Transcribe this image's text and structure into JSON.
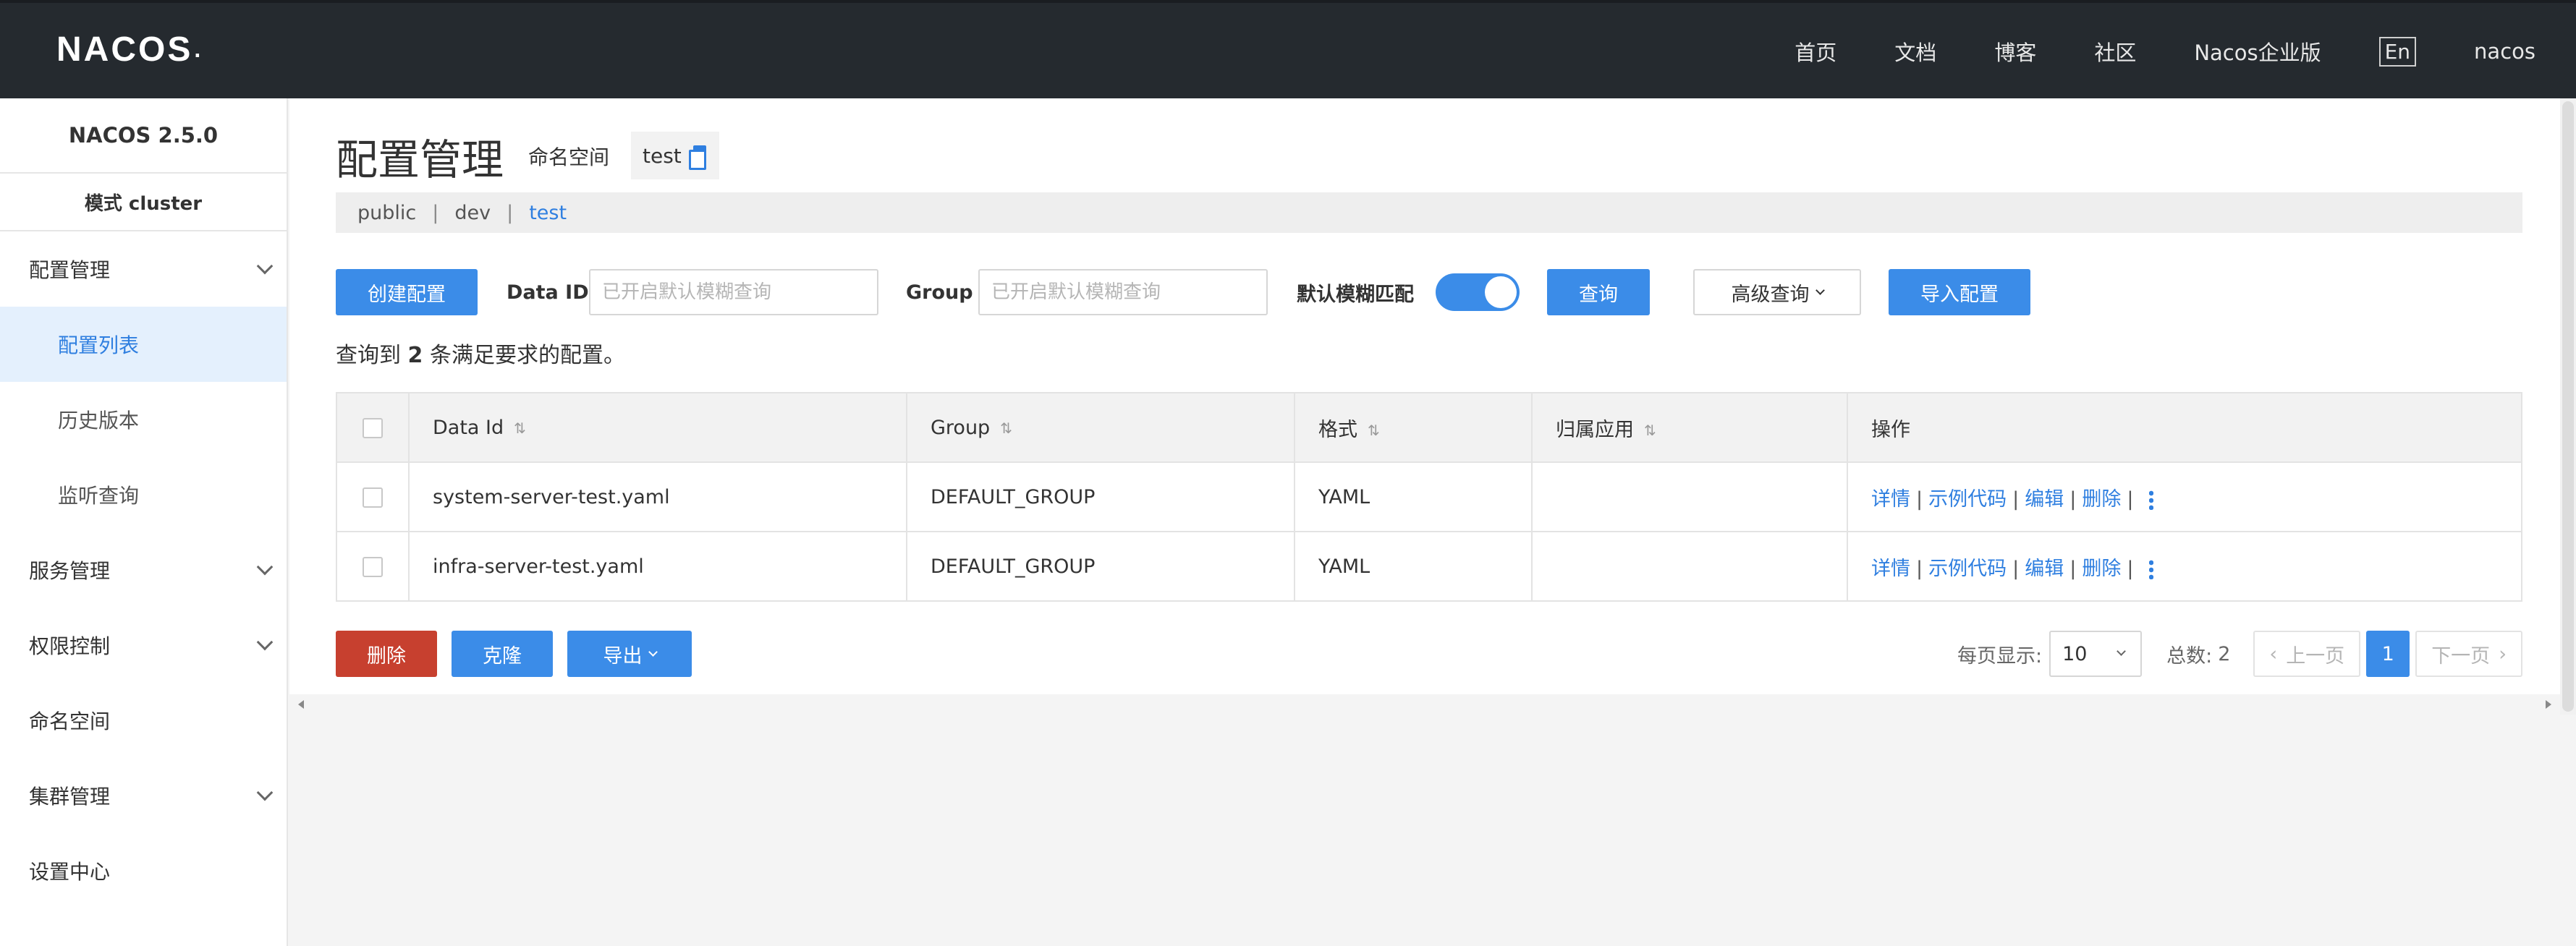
{
  "topbar": {
    "logo": "NACOS",
    "logo_dot": ".",
    "nav": [
      "首页",
      "文档",
      "博客",
      "社区",
      "Nacos企业版"
    ],
    "lang": "En",
    "user": "nacos"
  },
  "sidebar": {
    "version": "NACOS 2.5.0",
    "mode": "模式 cluster",
    "items": [
      {
        "label": "配置管理",
        "has_chevron": true
      },
      {
        "label": "配置列表",
        "active": true
      },
      {
        "label": "历史版本"
      },
      {
        "label": "监听查询"
      },
      {
        "label": "服务管理",
        "has_chevron": true
      },
      {
        "label": "权限控制",
        "has_chevron": true
      },
      {
        "label": "命名空间"
      },
      {
        "label": "集群管理",
        "has_chevron": true
      },
      {
        "label": "设置中心"
      }
    ]
  },
  "header": {
    "title": "配置管理",
    "namespace_label": "命名空间",
    "namespace_value": "test"
  },
  "namespaces": {
    "items": [
      "public",
      "dev",
      "test"
    ],
    "separator": "|",
    "active": "test"
  },
  "toolbar": {
    "create_label": "创建配置",
    "dataid_label": "Data ID",
    "dataid_placeholder": "已开启默认模糊查询",
    "group_label": "Group",
    "group_placeholder": "已开启默认模糊查询",
    "fuzzy_label": "默认模糊匹配",
    "fuzzy_on": true,
    "query_label": "查询",
    "advanced_label": "高级查询",
    "import_label": "导入配置"
  },
  "result": {
    "prefix": "查询到",
    "count": "2",
    "suffix": "条满足要求的配置。"
  },
  "table": {
    "columns": [
      "Data Id",
      "Group",
      "格式",
      "归属应用",
      "操作"
    ],
    "rows": [
      {
        "data_id": "system-server-test.yaml",
        "group": "DEFAULT_GROUP",
        "format": "YAML",
        "app": ""
      },
      {
        "data_id": "infra-server-test.yaml",
        "group": "DEFAULT_GROUP",
        "format": "YAML",
        "app": ""
      }
    ],
    "actions": {
      "detail": "详情",
      "sample": "示例代码",
      "edit": "编辑",
      "delete": "删除",
      "separator": "|"
    }
  },
  "footer": {
    "delete_label": "删除",
    "clone_label": "克隆",
    "export_label": "导出"
  },
  "pager": {
    "per_page_label": "每页显示:",
    "per_page_value": "10",
    "total_label": "总数:",
    "total_value": "2",
    "prev_label": "上一页",
    "current_page": "1",
    "next_label": "下一页"
  },
  "colors": {
    "accent": "#3b8ce8",
    "danger": "#c7402f",
    "topbar": "#252a2f",
    "active_nav_bg": "#e4f0fd"
  }
}
